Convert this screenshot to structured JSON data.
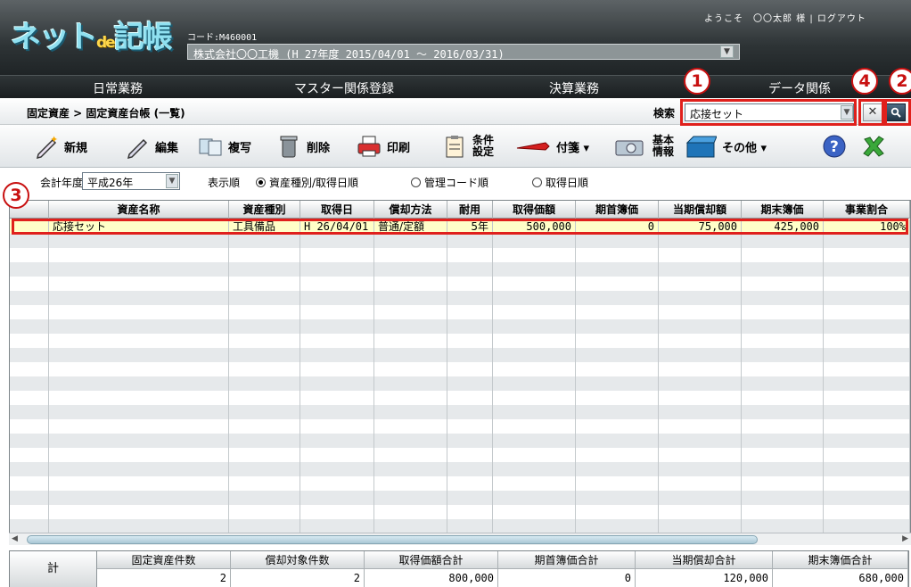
{
  "header": {
    "logo_main": "ネット",
    "logo_mid": "de",
    "logo_tail": "記帳",
    "code": "コード:M460001",
    "company": "株式会社〇〇工機 (H 27年度 2015/04/01 ～ 2016/03/31)",
    "welcome": "ようこそ　〇〇太郎 様 | ログアウト"
  },
  "nav": [
    "日常業務",
    "マスター関係登録",
    "決算業務",
    "データ関係"
  ],
  "breadcrumb": "固定資産 > 固定資産台帳 (一覧)",
  "search": {
    "label": "検索",
    "value": "応接セット"
  },
  "toolbar": {
    "new": "新規",
    "edit": "編集",
    "copy": "複写",
    "delete": "削除",
    "print": "印刷",
    "cond1": "条件",
    "cond2": "設定",
    "tag": "付箋 ▾",
    "basic1": "基本",
    "basic2": "情報",
    "other": "その他 ▾"
  },
  "options": {
    "fy_label": "会計年度",
    "fy_value": "平成26年",
    "order_label": "表示順",
    "radio1": "資産種別/取得日順",
    "radio2": "管理コード順",
    "radio3": "取得日順"
  },
  "table": {
    "headers": [
      "",
      "資産名称",
      "資産種別",
      "取得日",
      "償却方法",
      "耐用",
      "取得価額",
      "期首簿価",
      "当期償却額",
      "期末簿価",
      "事業割合"
    ],
    "rows": [
      [
        "",
        "応接セット",
        "工具備品",
        "H 26/04/01",
        "普通/定額",
        "5年",
        "500,000",
        "0",
        "75,000",
        "425,000",
        "100%"
      ]
    ]
  },
  "footer": {
    "sum_label": "計",
    "headers": [
      "固定資産件数",
      "償却対象件数",
      "取得価額合計",
      "期首簿価合計",
      "当期償却合計",
      "期末簿価合計"
    ],
    "values": [
      "2",
      "2",
      "800,000",
      "0",
      "120,000",
      "680,000"
    ]
  },
  "callouts": [
    "1",
    "2",
    "3",
    "4"
  ],
  "colors": {
    "accent_red": "#e0201c",
    "header_dark": "#2e3436",
    "selected_row": "#ffffc8"
  }
}
